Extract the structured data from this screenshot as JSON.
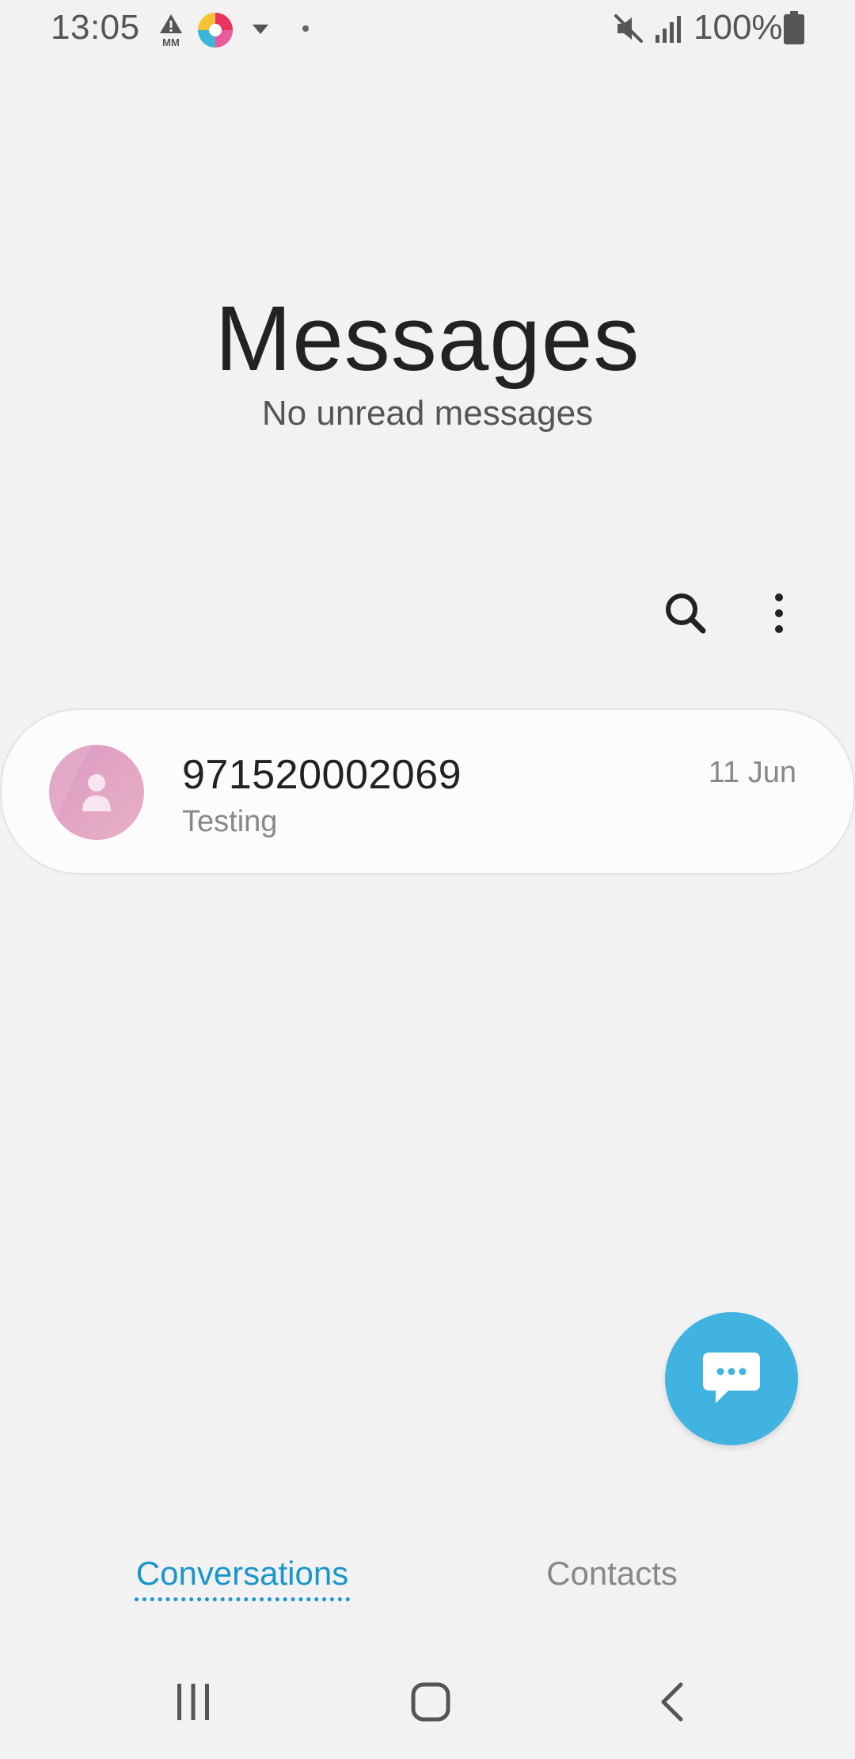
{
  "status_bar": {
    "time": "13:05",
    "mm_label": "MM",
    "battery": "100%",
    "icons": [
      "mm-network-icon",
      "app-notification-icon",
      "dropdown-caret-icon",
      "dot-icon",
      "mute-icon",
      "signal-icon",
      "battery-icon"
    ]
  },
  "header": {
    "title": "Messages",
    "subtitle": "No unread messages"
  },
  "actions": {
    "icons": [
      "search-icon",
      "more-options-icon"
    ]
  },
  "conversations": [
    {
      "name": "971520002069",
      "snippet": "Testing",
      "date": "11 Jun",
      "avatar_icon": "person-icon",
      "avatar_color": "#e0a3c4"
    }
  ],
  "fab": {
    "icon": "new-message-icon",
    "color": "#40b3e0"
  },
  "tabs": [
    {
      "label": "Conversations",
      "selected": true
    },
    {
      "label": "Contacts",
      "selected": false
    }
  ],
  "nav": {
    "icons": [
      "recents-icon",
      "home-icon",
      "back-icon"
    ]
  },
  "colors": {
    "accent": "#1a96cc",
    "background": "#f2f2f2"
  }
}
